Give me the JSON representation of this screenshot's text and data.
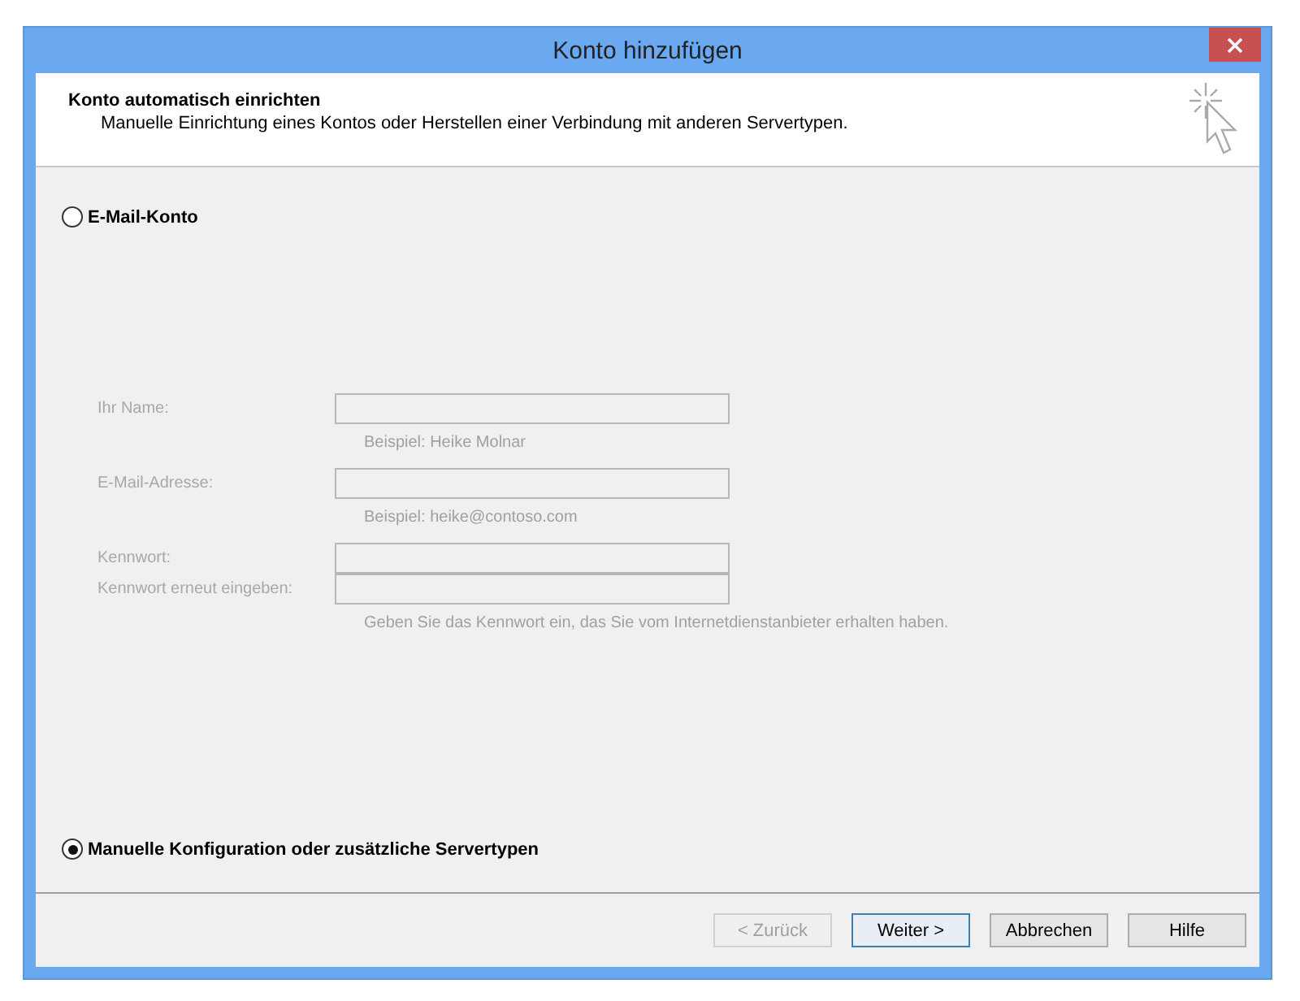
{
  "window": {
    "title": "Konto hinzufügen"
  },
  "header": {
    "title": "Konto automatisch einrichten",
    "subtitle": "Manuelle Einrichtung eines Kontos oder Herstellen einer Verbindung mit anderen Servertypen."
  },
  "options": [
    {
      "label": "E-Mail-Konto",
      "selected": false
    },
    {
      "label": "Manuelle Konfiguration oder zusätzliche Servertypen",
      "selected": true
    }
  ],
  "fields": [
    {
      "label": "Ihr Name:",
      "hint": "Beispiel: Heike Molnar",
      "disabled": true
    },
    {
      "label": "E-Mail-Adresse:",
      "hint": "Beispiel: heike@contoso.com",
      "disabled": true
    },
    {
      "label": "Kennwort:",
      "disabled": true
    },
    {
      "label": "Kennwort erneut eingeben:",
      "hint": "Geben Sie das Kennwort ein, das Sie vom Internetdienstanbieter erhalten haben.",
      "disabled": true
    }
  ],
  "buttons": [
    {
      "label": "< Zurück",
      "disabled": true,
      "default": false
    },
    {
      "label": "Weiter >",
      "disabled": false,
      "default": true
    },
    {
      "label": "Abbrechen",
      "disabled": false,
      "default": false
    },
    {
      "label": "Hilfe",
      "disabled": false,
      "default": false
    }
  ]
}
